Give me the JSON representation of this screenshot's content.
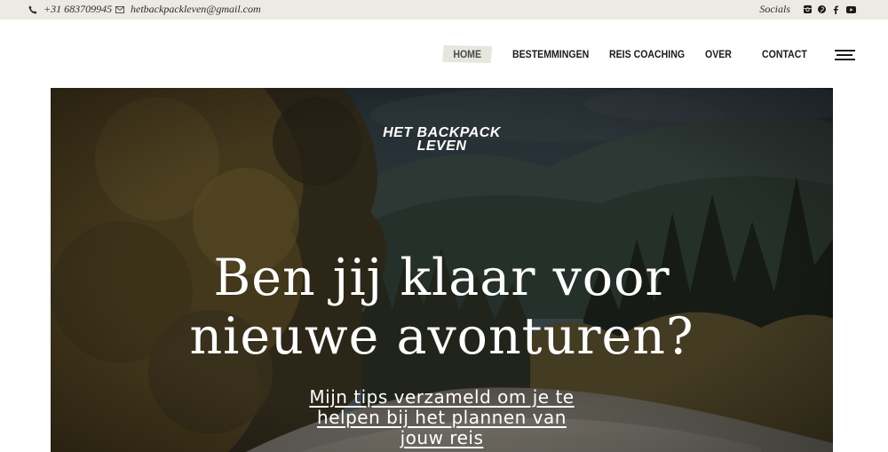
{
  "topbar": {
    "phone": "+31 683709945",
    "email": "hetbackpackleven@gmail.com",
    "socials_label": "Socials",
    "social_icons": [
      "instagram-icon",
      "pinterest-icon",
      "facebook-icon",
      "youtube-icon"
    ]
  },
  "nav": {
    "items": [
      {
        "label": "HOME",
        "active": true
      },
      {
        "label": "BESTEMMINGEN"
      },
      {
        "label": "REIS COACHING"
      },
      {
        "label": "OVER"
      },
      {
        "label": "CONTACT"
      }
    ]
  },
  "hero": {
    "brand_line1": "HET BACKPACK",
    "brand_line2": "LEVEN",
    "headline_line1": "Ben jij klaar voor",
    "headline_line2": "nieuwe avonturen?",
    "tips_line1": "Mijn tips verzameld om je te",
    "tips_line2": "helpen bij het plannen van",
    "tips_line3": "jouw reis"
  },
  "colors": {
    "topbar_bg": "#ecebe3",
    "active_nav_bg": "#e6e6df",
    "text_dark": "#1a1a1a",
    "hero_text": "#ffffff"
  }
}
